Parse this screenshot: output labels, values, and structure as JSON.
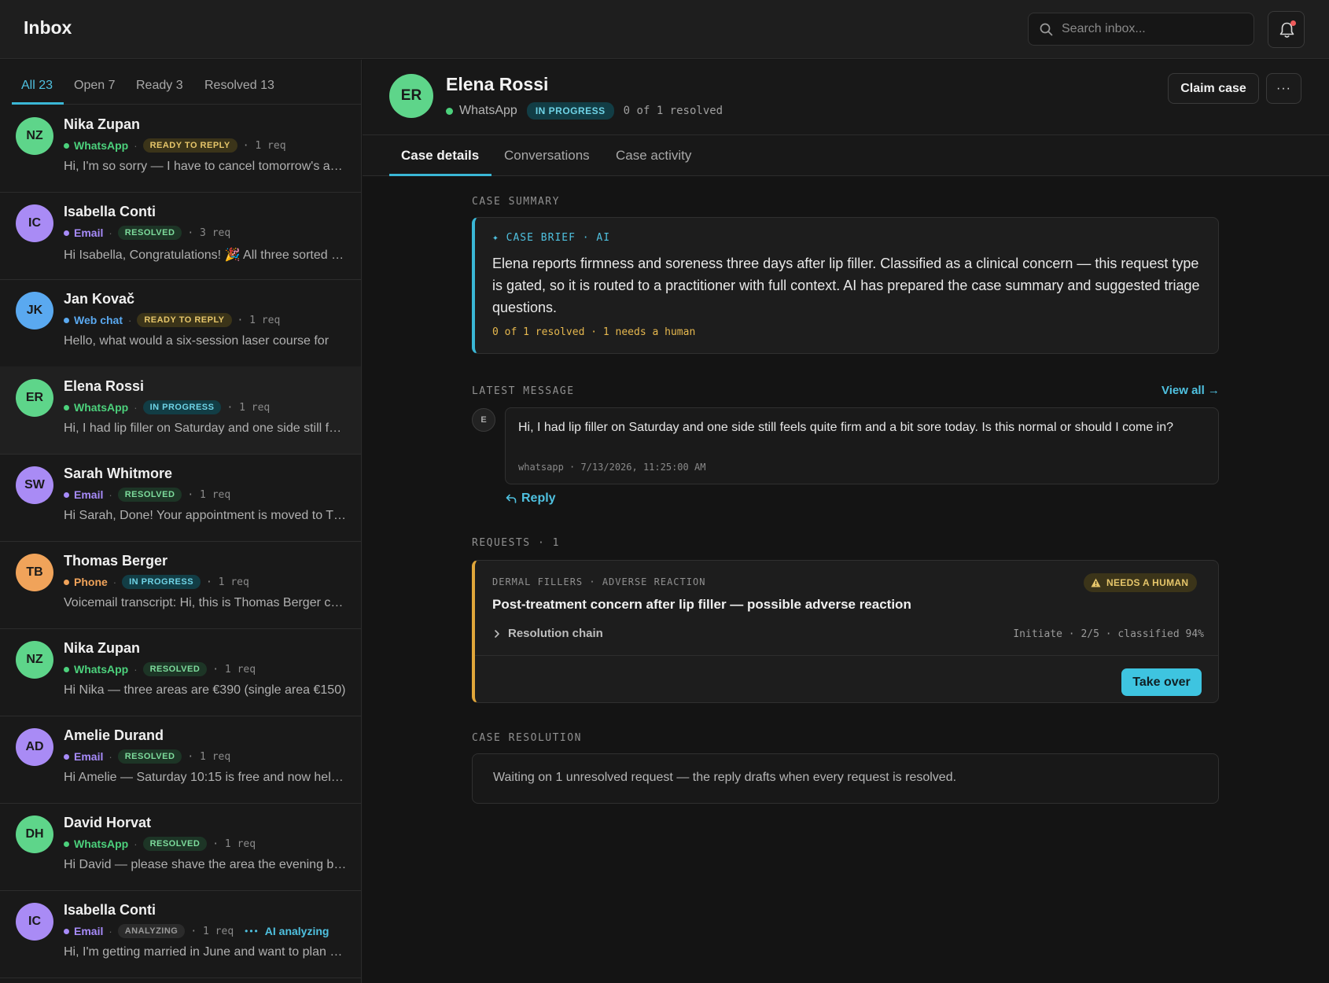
{
  "app": {
    "title": "Inbox"
  },
  "search": {
    "placeholder": "Search inbox..."
  },
  "filters": [
    {
      "label": "All",
      "count": "23"
    },
    {
      "label": "Open",
      "count": "7"
    },
    {
      "label": "Ready",
      "count": "3"
    },
    {
      "label": "Resolved",
      "count": "13"
    }
  ],
  "conversations": [
    {
      "initials": "NZ",
      "name": "Nika Zupan",
      "channel": "WhatsApp",
      "status": "READY TO REPLY",
      "reqs": "· 1 req",
      "preview": "Hi, I'm so sorry — I have to cancel tomorrow's appointment",
      "ai": ""
    },
    {
      "initials": "IC",
      "name": "Isabella Conti",
      "channel": "Email",
      "status": "RESOLVED",
      "reqs": "· 3 req",
      "preview": "Hi Isabella, Congratulations! 🎉 All three sorted for you",
      "ai": ""
    },
    {
      "initials": "JK",
      "name": "Jan Kovač",
      "channel": "Web chat",
      "status": "READY TO REPLY",
      "reqs": "· 1 req",
      "preview": "Hello, what would a six-session laser course for",
      "ai": ""
    },
    {
      "initials": "ER",
      "name": "Elena Rossi",
      "channel": "WhatsApp",
      "status": "IN PROGRESS",
      "reqs": "· 1 req",
      "preview": "Hi, I had lip filler on Saturday and one side still feels",
      "ai": ""
    },
    {
      "initials": "SW",
      "name": "Sarah Whitmore",
      "channel": "Email",
      "status": "RESOLVED",
      "reqs": "· 1 req",
      "preview": "Hi Sarah, Done! Your appointment is moved to Thursday",
      "ai": ""
    },
    {
      "initials": "TB",
      "name": "Thomas Berger",
      "channel": "Phone",
      "status": "IN PROGRESS",
      "reqs": "· 1 req",
      "preview": "Voicemail transcript: Hi, this is Thomas Berger calling",
      "ai": ""
    },
    {
      "initials": "NZ",
      "name": "Nika Zupan",
      "channel": "WhatsApp",
      "status": "RESOLVED",
      "reqs": "· 1 req",
      "preview": "Hi Nika — three areas are €390 (single area €150)",
      "ai": ""
    },
    {
      "initials": "AD",
      "name": "Amelie Durand",
      "channel": "Email",
      "status": "RESOLVED",
      "reqs": "· 1 req",
      "preview": "Hi Amelie — Saturday 10:15 is free and now held for you",
      "ai": ""
    },
    {
      "initials": "DH",
      "name": "David Horvat",
      "channel": "WhatsApp",
      "status": "RESOLVED",
      "reqs": "· 1 req",
      "preview": "Hi David — please shave the area the evening before",
      "ai": ""
    },
    {
      "initials": "IC",
      "name": "Isabella Conti",
      "channel": "Email",
      "status": "ANALYZING",
      "reqs": "· 1 req",
      "preview": "Hi, I'm getting married in June and want to plan ahead",
      "ai": "AI analyzing"
    }
  ],
  "case": {
    "initials": "ER",
    "name": "Elena Rossi",
    "channel": "WhatsApp",
    "status": "IN PROGRESS",
    "progress": "0 of 1 resolved",
    "claim_label": "Claim case",
    "more_label": "···"
  },
  "detail_tabs": [
    "Case details",
    "Conversations",
    "Case activity"
  ],
  "summary": {
    "section": "CASE SUMMARY",
    "label": "✦ CASE BRIEF · AI",
    "text": "Elena reports firmness and soreness three days after lip filler. Classified as a clinical concern — this request type is gated, so it is routed to a practitioner with full context. AI has prepared the case summary and suggested triage questions.",
    "footer": "0 of 1 resolved · 1 needs a human"
  },
  "latest": {
    "section": "LATEST MESSAGE",
    "view_all": "View all →",
    "avatar": "E",
    "text": "Hi, I had lip filler on Saturday and one side still feels quite firm and a bit sore today. Is this normal or should I come in?",
    "stamp": "whatsapp · 7/13/2026, 11:25:00 AM",
    "reply_label": "Reply"
  },
  "requests": {
    "section": "REQUESTS · 1",
    "category": "DERMAL FILLERS · ADVERSE REACTION",
    "badge": "NEEDS A HUMAN",
    "title": "Post-treatment concern after lip filler — possible adverse reaction",
    "chain_label": "Resolution chain",
    "status": "Initiate · 2/5 · classified 94%",
    "take_over": "Take over"
  },
  "resolution": {
    "section": "CASE RESOLUTION",
    "text": "Waiting on 1 unresolved request — the reply drafts when every request is resolved."
  },
  "colors": {
    "accent": "#3ab7d6",
    "whatsapp": "#4cd17c",
    "email": "#a78bfa",
    "webchat": "#5aa9f0",
    "phone": "#f0a35a",
    "warning": "#e0a63a"
  }
}
